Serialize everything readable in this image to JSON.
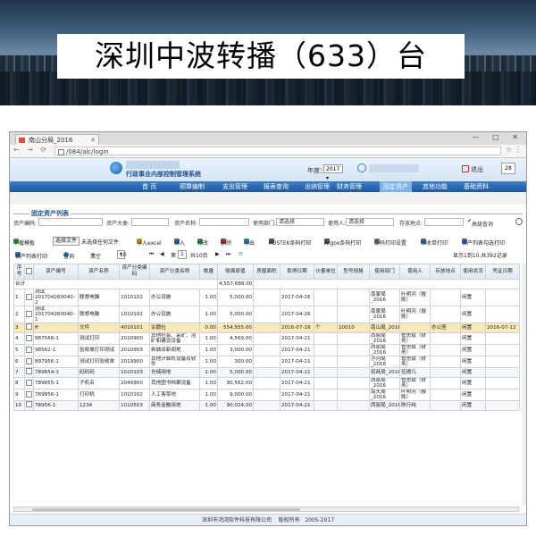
{
  "banner": {
    "title": "深圳中波转播（633）台"
  },
  "browser": {
    "tab_title": "南山分局_2016",
    "url": "/084/alc/login",
    "window_controls": "— □ ✕"
  },
  "header": {
    "system_name": "行政事业内部控制管理系统",
    "year_label": "年度：",
    "year_value": "2017 ▾",
    "logout_label": "退出",
    "msg_count": "28"
  },
  "menu": {
    "items": [
      "首 页",
      "预算编制",
      "支出管理",
      "报表查询",
      "出纳管理",
      "财务管理",
      "固定资产",
      "其他功能",
      "基础资料"
    ],
    "active": "固定资产"
  },
  "section": {
    "title": "固定资产列表",
    "search": {
      "asset_code": "资产编码:",
      "asset_class": "资产大类:",
      "asset_name": "资产名称:",
      "dept_label": "使用部门:",
      "dept_value": "请选择",
      "user_label": "使用人:",
      "user_value": "请选择",
      "location_label": "存放地点:",
      "advanced": "高级查询"
    }
  },
  "toolbar1": {
    "download": "下载模板",
    "choose_file": "选择文件",
    "no_file": "未选择任何文件",
    "import_excel": "导入excel",
    "add": "录入",
    "edit": "修改",
    "delete": "删除",
    "export": "导出",
    "postek": "POSTEK条码打印",
    "argox": "Argox条码打印",
    "barcode_settings": "条码打印设置",
    "receipt": "验收单打印",
    "asset_card": "资产列表勾选打印"
  },
  "toolbar2": {
    "batch_print": "资产列表打印",
    "query": "查询",
    "clear": "清空",
    "page_size": "10",
    "import": "导入excel",
    "page_label": "第",
    "page_num": "1",
    "total_pages": "共10页",
    "summary": "显示1到10,共392记录"
  },
  "table": {
    "headers": [
      "序号",
      "",
      "资产编号",
      "资产名称",
      "资产分类编码",
      "资产分类名称",
      "数量",
      "账面原值",
      "房屋面积",
      "取得日期",
      "计量单位",
      "型号规格",
      "使用部门",
      "使用人",
      "存放地点",
      "使用状况",
      "凭证日期"
    ],
    "total_row": {
      "label": "合计",
      "amount": "4,557,688.00"
    },
    "rows": [
      {
        "seq": "1",
        "code": "测试201704260040-2",
        "name": "联想电脑",
        "class_code": "1010102",
        "class_name": "办公设施",
        "qty": "1.00",
        "value": "5,000.00",
        "area": "",
        "date": "2017-04-26",
        "unit": "",
        "model": "",
        "dept": "南蒙局_2016",
        "user": "叶明河（报账）",
        "loc": "",
        "status": "闲置",
        "vdate": "",
        "style": "tall"
      },
      {
        "seq": "2",
        "code": "测试201704260040-1",
        "name": "联想电脑",
        "class_code": "1010102",
        "class_name": "办公设施",
        "qty": "1.00",
        "value": "5,000.00",
        "area": "",
        "date": "2017-04-26",
        "unit": "",
        "model": "",
        "dept": "南蒙局_2016",
        "user": "叶明河（报账）",
        "loc": "",
        "status": "闲置",
        "vdate": "",
        "style": "tall"
      },
      {
        "seq": "3",
        "code": "ff",
        "name": "文件",
        "class_code": "4010101",
        "class_name": "古籍社",
        "qty": "0.00",
        "value": "554,555.00",
        "area": "",
        "date": "2016-07-19",
        "unit": "个",
        "model": "10010",
        "dept": "南山局_2016",
        "user": "",
        "loc": "办公室",
        "status": "闲置",
        "vdate": "2016-07-12",
        "style": "sel"
      },
      {
        "seq": "4",
        "code": "987566-1",
        "name": "测试打印",
        "class_code": "2010900",
        "class_name": "其他社会、采矿、冶矿和建设设备",
        "qty": "1.00",
        "value": "4,569.00",
        "area": "",
        "date": "2017-04-21",
        "unit": "",
        "model": "",
        "dept": "西丽局_2016",
        "user": "管思斌（财务）",
        "loc": "",
        "status": "闲置",
        "vdate": "",
        "style": "tall"
      },
      {
        "seq": "5",
        "code": "98562-1",
        "name": "验收单打印测试",
        "class_code": "2010903",
        "class_name": "新城出新闻地",
        "qty": "1.00",
        "value": "3,000.00",
        "area": "",
        "date": "2017-04-21",
        "unit": "",
        "model": "",
        "dept": "西丽局_2016",
        "user": "管思斌（财务）",
        "loc": "",
        "status": "闲置",
        "vdate": "",
        "style": "tall"
      },
      {
        "seq": "6",
        "code": "897956-1",
        "name": "测试打印验收单",
        "class_code": "2019900",
        "class_name": "其他计算机设备及软件",
        "qty": "1.00",
        "value": "300.00",
        "area": "",
        "date": "2017-04-21",
        "unit": "",
        "model": "",
        "dept": "沙河局_2016",
        "user": "管思斌（财务）",
        "loc": "",
        "status": "闲置",
        "vdate": "",
        "style": "tall"
      },
      {
        "seq": "7",
        "code": "789654-1",
        "name": "码码码",
        "class_code": "1010103",
        "class_name": "仓储用地",
        "qty": "1.00",
        "value": "5,000.00",
        "area": "",
        "date": "2017-04-21",
        "unit": "",
        "model": "",
        "dept": "招商局_2016",
        "user": "伍德凡",
        "loc": "",
        "status": "闲置",
        "vdate": "",
        "style": "alt"
      },
      {
        "seq": "8",
        "code": "789855-1",
        "name": "子机名",
        "class_code": "2049900",
        "class_name": "其他图书档案设备",
        "qty": "1.00",
        "value": "90,562.00",
        "area": "",
        "date": "2017-04-21",
        "unit": "",
        "model": "",
        "dept": "西丽局_2016",
        "user": "管思斌（财务）",
        "loc": "",
        "status": "闲置",
        "vdate": "",
        "style": "tall"
      },
      {
        "seq": "9",
        "code": "789856-1",
        "name": "打印机",
        "class_code": "1010102",
        "class_name": "人工客草地",
        "qty": "1.00",
        "value": "9,000.00",
        "area": "",
        "date": "2017-04-21",
        "unit": "",
        "model": "",
        "dept": "南头局_2016",
        "user": "叶明河（报账）",
        "loc": "",
        "status": "闲置",
        "vdate": "",
        "style": "tall"
      },
      {
        "seq": "10",
        "code": "78956-1",
        "name": "1234",
        "class_code": "1010503",
        "class_name": "商务金融用地",
        "qty": "1.00",
        "value": "90,024.00",
        "area": "",
        "date": "2017-04-21",
        "unit": "",
        "model": "",
        "dept": "西丽局_2016",
        "user": "陈行纯",
        "loc": "",
        "status": "闲置",
        "vdate": "",
        "style": "alt"
      }
    ]
  },
  "footer": {
    "company": "深圳市鸿湾软件科技有限公司",
    "rights": "版权所有",
    "years": "2005-2017"
  },
  "colors": {
    "menu_bg": "#21589e",
    "menu_active": "#7fb3e6",
    "selected_row": "#f9e9b9"
  }
}
